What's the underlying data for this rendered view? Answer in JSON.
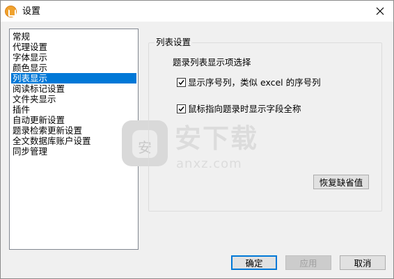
{
  "window": {
    "title": "设置"
  },
  "sidebar": {
    "items": [
      {
        "label": "常规"
      },
      {
        "label": "代理设置"
      },
      {
        "label": "字体显示"
      },
      {
        "label": "颜色显示"
      },
      {
        "label": "列表显示"
      },
      {
        "label": "阅读标记设置"
      },
      {
        "label": "文件夹显示"
      },
      {
        "label": "插件"
      },
      {
        "label": "自动更新设置"
      },
      {
        "label": "题录检索更新设置"
      },
      {
        "label": "全文数据库账户设置"
      },
      {
        "label": "同步管理"
      }
    ],
    "selected_index": 4
  },
  "panel": {
    "group_title": "列表设置",
    "subtitle": "题录列表显示项选择",
    "options": [
      {
        "label": "显示序号列，类似 excel 的序号列",
        "checked": true
      },
      {
        "label": "鼠标指向题录时显示字段全称",
        "checked": true
      }
    ],
    "restore_label": "恢复缺省值"
  },
  "watermark": {
    "big": "安下载",
    "small": "anxz.com",
    "shield_char": "安"
  },
  "footer": {
    "ok_label": "确定",
    "apply_label": "应用",
    "cancel_label": "取消"
  },
  "colors": {
    "selection": "#0078d7",
    "dialog_bg": "#f0f0f0",
    "accent_icon": "#f0a22e"
  }
}
